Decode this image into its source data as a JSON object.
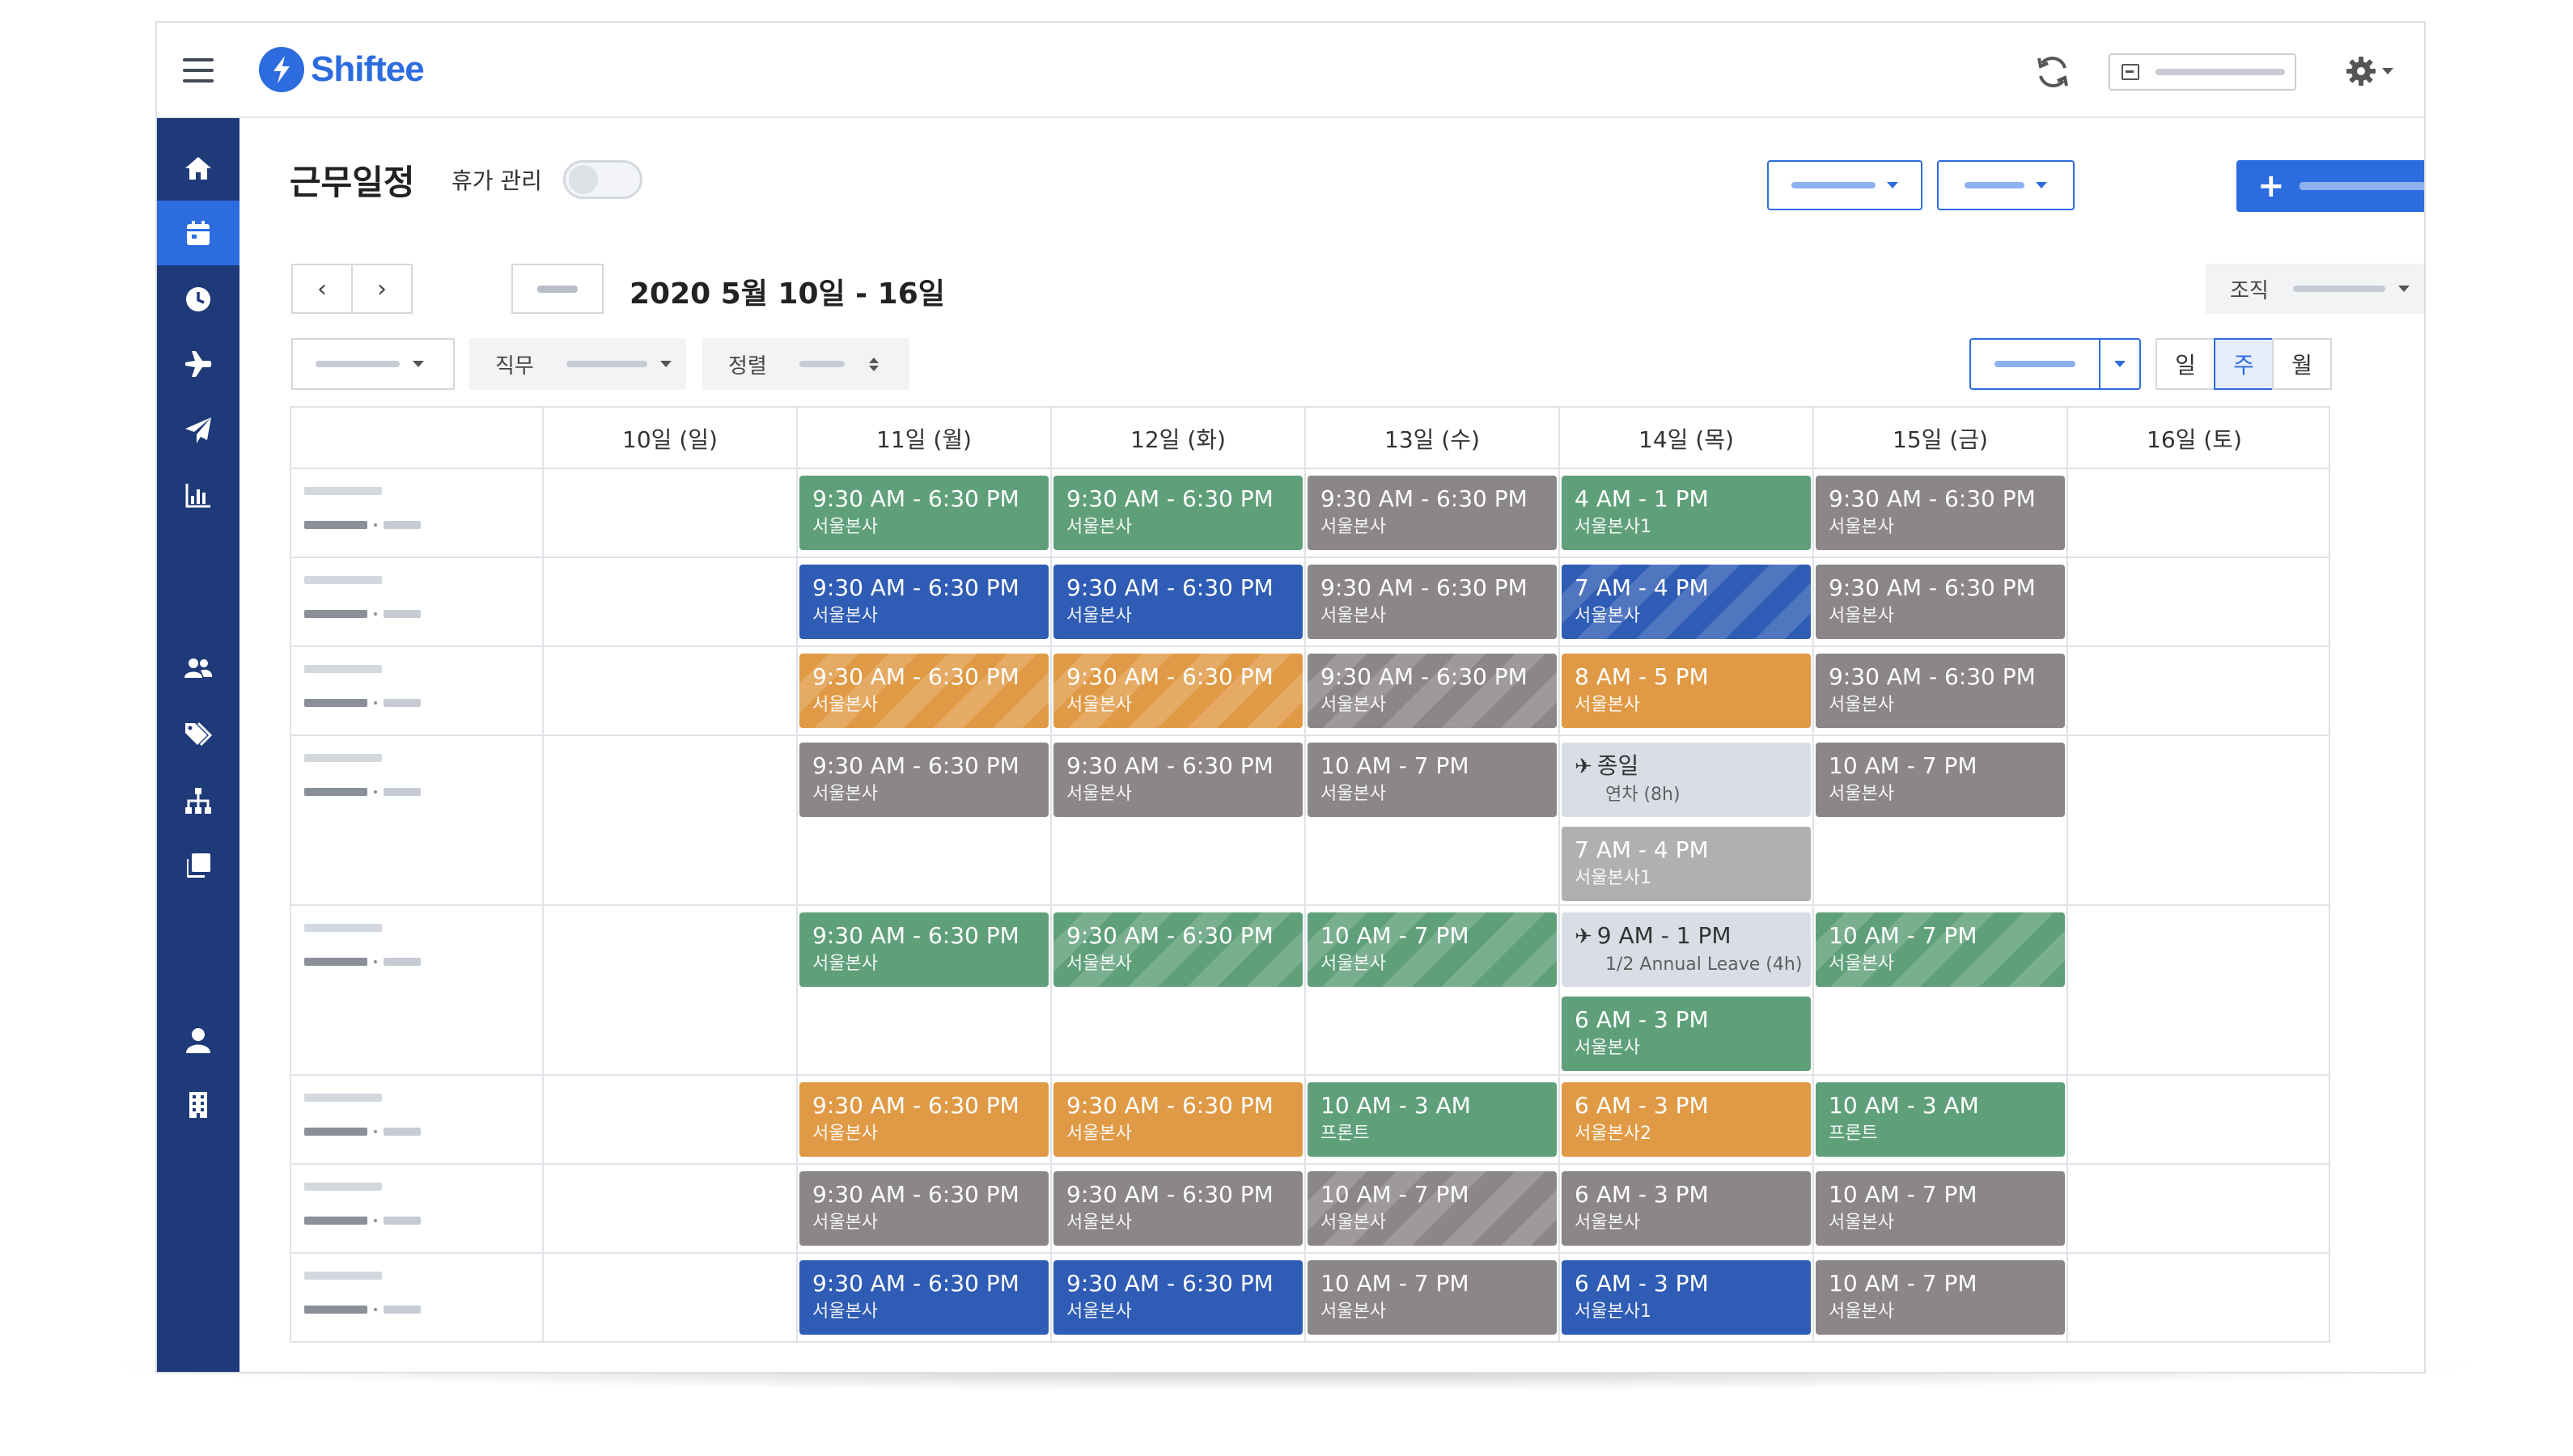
{
  "app": {
    "name": "Shiftee"
  },
  "colors": {
    "brand": "#2d6cdf",
    "sidebar": "#1e3a78",
    "shift_green": "#5fa07a",
    "shift_blue": "#2f5cb4",
    "shift_orange": "#e09a45",
    "shift_gray": "#8b8688",
    "leave_bg": "#d9dde5"
  },
  "topbar": {
    "icons": [
      "hamburger-icon",
      "refresh-icon",
      "login-icon",
      "gear-icon"
    ]
  },
  "sidebar": {
    "items": [
      {
        "icon": "home-icon",
        "active": false
      },
      {
        "icon": "calendar-icon",
        "active": true
      },
      {
        "icon": "clock-icon",
        "active": false
      },
      {
        "icon": "airplane-icon",
        "active": false
      },
      {
        "icon": "paper-plane-icon",
        "active": false
      },
      {
        "icon": "bar-chart-icon",
        "active": false
      },
      {
        "icon": "users-icon",
        "active": false
      },
      {
        "icon": "tags-icon",
        "active": false
      },
      {
        "icon": "org-chart-icon",
        "active": false
      },
      {
        "icon": "copy-icon",
        "active": false
      },
      {
        "icon": "user-icon",
        "active": false
      },
      {
        "icon": "building-icon",
        "active": false
      }
    ]
  },
  "header": {
    "title": "근무일정",
    "leave_toggle_label": "휴가 관리",
    "leave_toggle_on": false,
    "add_button_plus": "+"
  },
  "toolbar": {
    "prev": "‹",
    "next": "›",
    "date_range": "2020 5월 10일 - 16일",
    "org_label": "조직",
    "filter_job_label": "직무",
    "sort_label": "정렬",
    "view_modes": [
      "일",
      "주",
      "월"
    ],
    "active_view": "주"
  },
  "schedule": {
    "days": [
      "10일 (일)",
      "11일 (월)",
      "12일 (화)",
      "13일 (수)",
      "14일 (목)",
      "15일 (금)",
      "16일 (토)"
    ],
    "rows": [
      {
        "cells": [
          [],
          [
            {
              "time": "9:30 AM - 6:30 PM",
              "loc": "서울본사",
              "color": "green"
            }
          ],
          [
            {
              "time": "9:30 AM - 6:30 PM",
              "loc": "서울본사",
              "color": "green"
            }
          ],
          [
            {
              "time": "9:30 AM - 6:30 PM",
              "loc": "서울본사",
              "color": "gray"
            }
          ],
          [
            {
              "time": "4 AM - 1 PM",
              "loc": "서울본사1",
              "color": "green"
            }
          ],
          [
            {
              "time": "9:30 AM - 6:30 PM",
              "loc": "서울본사",
              "color": "gray"
            }
          ],
          []
        ]
      },
      {
        "cells": [
          [],
          [
            {
              "time": "9:30 AM - 6:30 PM",
              "loc": "서울본사",
              "color": "blue"
            }
          ],
          [
            {
              "time": "9:30 AM - 6:30 PM",
              "loc": "서울본사",
              "color": "blue"
            }
          ],
          [
            {
              "time": "9:30 AM - 6:30 PM",
              "loc": "서울본사",
              "color": "gray"
            }
          ],
          [
            {
              "time": "7 AM - 4 PM",
              "loc": "서울본사",
              "color": "blue",
              "striped": true
            }
          ],
          [
            {
              "time": "9:30 AM - 6:30 PM",
              "loc": "서울본사",
              "color": "gray"
            }
          ],
          []
        ]
      },
      {
        "cells": [
          [],
          [
            {
              "time": "9:30 AM - 6:30 PM",
              "loc": "서울본사",
              "color": "orange",
              "striped": true
            }
          ],
          [
            {
              "time": "9:30 AM - 6:30 PM",
              "loc": "서울본사",
              "color": "orange",
              "striped": true
            }
          ],
          [
            {
              "time": "9:30 AM - 6:30 PM",
              "loc": "서울본사",
              "color": "gray",
              "striped": true
            }
          ],
          [
            {
              "time": "8 AM - 5 PM",
              "loc": "서울본사",
              "color": "orange"
            }
          ],
          [
            {
              "time": "9:30 AM - 6:30 PM",
              "loc": "서울본사",
              "color": "gray"
            }
          ],
          []
        ]
      },
      {
        "cells": [
          [],
          [
            {
              "time": "9:30 AM - 6:30 PM",
              "loc": "서울본사",
              "color": "gray"
            }
          ],
          [
            {
              "time": "9:30 AM - 6:30 PM",
              "loc": "서울본사",
              "color": "gray"
            }
          ],
          [
            {
              "time": "10 AM - 7 PM",
              "loc": "서울본사",
              "color": "gray"
            }
          ],
          [
            {
              "time": "종일",
              "loc": "연차 (8h)",
              "color": "leave",
              "leave": true
            },
            {
              "time": "7 AM - 4 PM",
              "loc": "서울본사1",
              "color": "lightgray"
            }
          ],
          [
            {
              "time": "10 AM - 7 PM",
              "loc": "서울본사",
              "color": "gray"
            }
          ],
          []
        ]
      },
      {
        "cells": [
          [],
          [
            {
              "time": "9:30 AM - 6:30 PM",
              "loc": "서울본사",
              "color": "green"
            }
          ],
          [
            {
              "time": "9:30 AM - 6:30 PM",
              "loc": "서울본사",
              "color": "green",
              "striped": true
            }
          ],
          [
            {
              "time": "10 AM - 7 PM",
              "loc": "서울본사",
              "color": "green",
              "striped": true
            }
          ],
          [
            {
              "time": "9 AM - 1 PM",
              "loc": "1/2 Annual Leave (4h)",
              "color": "leave",
              "leave": true
            },
            {
              "time": "6 AM - 3 PM",
              "loc": "서울본사",
              "color": "green"
            }
          ],
          [
            {
              "time": "10 AM - 7 PM",
              "loc": "서울본사",
              "color": "green",
              "striped": true
            }
          ],
          []
        ]
      },
      {
        "cells": [
          [],
          [
            {
              "time": "9:30 AM - 6:30 PM",
              "loc": "서울본사",
              "color": "orange"
            }
          ],
          [
            {
              "time": "9:30 AM - 6:30 PM",
              "loc": "서울본사",
              "color": "orange"
            }
          ],
          [
            {
              "time": "10 AM - 3 AM",
              "loc": "프론트",
              "color": "green"
            }
          ],
          [
            {
              "time": "6 AM - 3 PM",
              "loc": "서울본사2",
              "color": "orange"
            }
          ],
          [
            {
              "time": "10 AM - 3 AM",
              "loc": "프론트",
              "color": "green"
            }
          ],
          []
        ]
      },
      {
        "cells": [
          [],
          [
            {
              "time": "9:30 AM - 6:30 PM",
              "loc": "서울본사",
              "color": "gray"
            }
          ],
          [
            {
              "time": "9:30 AM - 6:30 PM",
              "loc": "서울본사",
              "color": "gray"
            }
          ],
          [
            {
              "time": "10 AM - 7 PM",
              "loc": "서울본사",
              "color": "gray",
              "striped": true
            }
          ],
          [
            {
              "time": "6 AM - 3 PM",
              "loc": "서울본사",
              "color": "gray"
            }
          ],
          [
            {
              "time": "10 AM - 7 PM",
              "loc": "서울본사",
              "color": "gray"
            }
          ],
          []
        ]
      },
      {
        "cells": [
          [],
          [
            {
              "time": "9:30 AM - 6:30 PM",
              "loc": "서울본사",
              "color": "blue"
            }
          ],
          [
            {
              "time": "9:30 AM - 6:30 PM",
              "loc": "서울본사",
              "color": "blue"
            }
          ],
          [
            {
              "time": "10 AM - 7 PM",
              "loc": "서울본사",
              "color": "gray"
            }
          ],
          [
            {
              "time": "6 AM - 3 PM",
              "loc": "서울본사1",
              "color": "blue"
            }
          ],
          [
            {
              "time": "10 AM - 7 PM",
              "loc": "서울본사",
              "color": "gray"
            }
          ],
          []
        ]
      }
    ]
  }
}
